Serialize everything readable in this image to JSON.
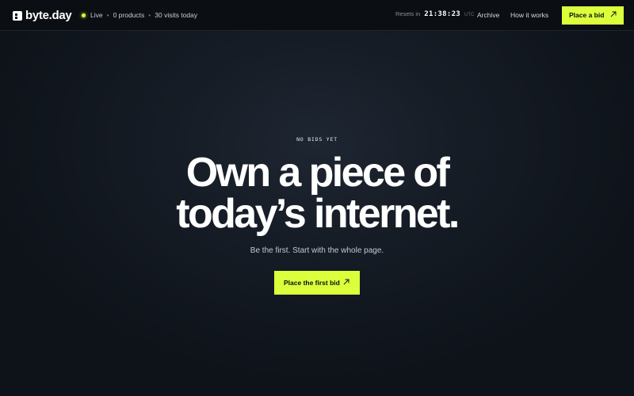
{
  "header": {
    "logo_text": "byte.day",
    "status": {
      "live_label": "Live",
      "products": "0 products",
      "visits": "30 visits today",
      "separator": "•"
    },
    "resets": {
      "label": "Resets in",
      "time": "21:38:23",
      "timezone": "UTC"
    },
    "nav": {
      "archive": "Archive",
      "how_it_works": "How it works"
    },
    "cta_label": "Place a bid"
  },
  "hero": {
    "eyebrow": "NO BIDS YET",
    "headline_line1": "Own a piece of",
    "headline_line2": "today’s internet.",
    "subtitle": "Be the first. Start with the whole page.",
    "cta_label": "Place the first bid"
  },
  "icons": {
    "logo": "logo-mark-icon",
    "live": "live-dot-icon",
    "arrow": "arrow-up-right-icon"
  },
  "colors": {
    "accent": "#dcff3c",
    "background": "#0d1117",
    "topbar": "#0b0e12"
  }
}
